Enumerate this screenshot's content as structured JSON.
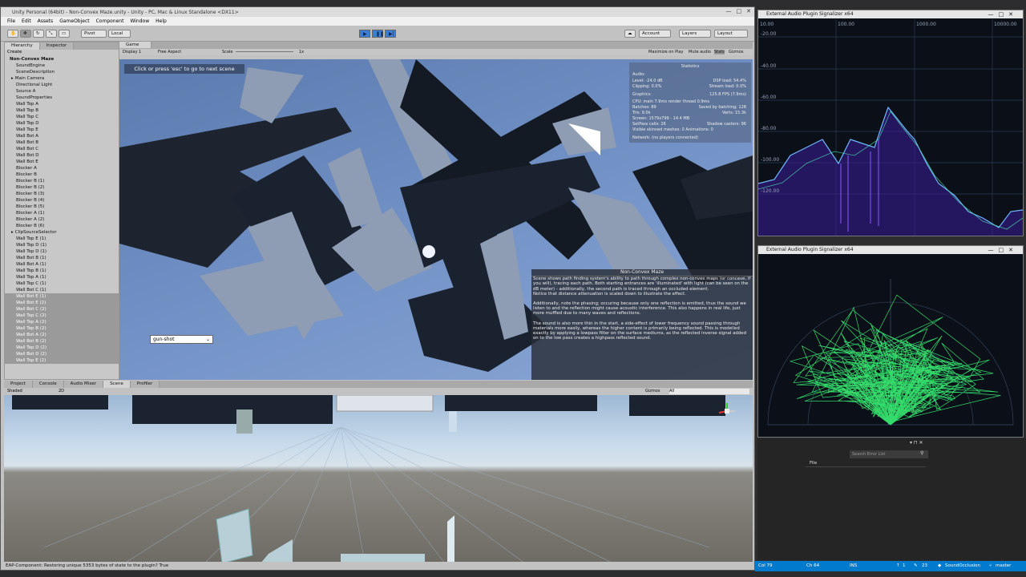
{
  "unity": {
    "window_title": "Unity Personal (64bit) - Non-Convex Maze.unity - Unity - PC, Mac & Linux Standalone <DX11>",
    "menu": [
      "File",
      "Edit",
      "Assets",
      "GameObject",
      "Component",
      "Window",
      "Help"
    ],
    "toolbar": {
      "pivot": "Pivot",
      "local": "Local",
      "account": "Account",
      "layers": "Layers",
      "layout": "Layout"
    },
    "hierarchy": {
      "tabs": [
        "Hierarchy",
        "Inspector"
      ],
      "create": "Create",
      "root": "Non-Convex Maze",
      "items": [
        "SoundEngine",
        "SceneDescription",
        "Main Camera",
        "Directional Light",
        "Source A",
        "SoundProperties",
        "Wall Top A",
        "Wall Top B",
        "Wall Top C",
        "Wall Top D",
        "Wall Top E",
        "Wall Bot A",
        "Wall Bot B",
        "Wall Bot C",
        "Wall Bot D",
        "Wall Bot E",
        "Blocker A",
        "Blocker B",
        "Blocker B (1)",
        "Blocker B (2)",
        "Blocker B (3)",
        "Blocker B (4)",
        "Blocker B (5)",
        "Blocker A (1)",
        "Blocker A (2)",
        "Blocker B (6)",
        "ClipSourceSelector",
        "Wall Top E (1)",
        "Wall Top D (1)",
        "Wall Top D (1)",
        "Wall Bot B (1)",
        "Wall Bot A (1)",
        "Wall Top B (1)",
        "Wall Top A (1)",
        "Wall Top C (1)",
        "Wall Bot C (1)",
        "Wall Bot E (1)",
        "Wall Bot E (2)",
        "Wall Bot C (2)",
        "Wall Top C (2)",
        "Wall Top A (2)",
        "Wall Top B (2)",
        "Wall Bot A (2)",
        "Wall Bot B (2)",
        "Wall Top D (2)",
        "Wall Bot D (2)",
        "Wall Top E (2)"
      ]
    },
    "game": {
      "tab": "Game",
      "display": "Display 1",
      "aspect": "Free Aspect",
      "scale_label": "Scale",
      "scale_value": "1x",
      "toggles": [
        "Maximize on Play",
        "Mute audio",
        "Stats",
        "Gizmos"
      ],
      "hint": "Click or press 'esc' to go to next scene",
      "dropdown": "gun-shot",
      "stats": {
        "title": "Statistics",
        "audio_label": "Audio:",
        "level": "Level: -24.0 dB",
        "clipping": "Clipping: 0.0%",
        "dsp": "DSP load: 54.4%",
        "stream": "Stream load: 0.0%",
        "graphics_label": "Graphics:",
        "fps": "125.8 FPS (7.9ms)",
        "cpu": "CPU: main 7.9ms  render thread 0.9ms",
        "batches": "Batches: 89",
        "saved": "Saved by batching: 128",
        "tris": "Tris: 9.0k",
        "verts": "Verts: 15.3k",
        "screen": "Screen: 1579x799 - 14.4 MB",
        "setpass": "SetPass calls: 26",
        "shadow": "Shadow casters: 96",
        "skinned": "Visible skinned meshes: 0  Animations: 0",
        "network": "Network: (no players connected)"
      },
      "info": {
        "title": "Non-Convex Maze",
        "p1": "Scene shows path finding system's ability to path through complex non-convex maps (or concave, if you will), tracing each path. Both starting entrances are 'illuminated' with light (can be seen on the dB meter) - additionally, the second path is traced through an occluded element.",
        "p2": "Notice that distance attenuation is scaled down to illustrate the effect.",
        "p3": "Additionally, note the phasing; occuring because only one reflection is emitted, thus the sound we listen to and the reflection might cause acoustic interference. This also happens in real life, just more muffled due to many waves and reflections.",
        "p4": "The sound is also more thin in the start, a side-effect of lower frequency sound passing through materials more easily, whereas the higher content is primarily being reflected. This is modelled exactly by applying a lowpass filter on the surface mediums, as the reflected inverse signal added on to the low pass creates a highpass reflected sound."
      }
    },
    "scene": {
      "tabs": [
        "Project",
        "Console",
        "Audio Mixer",
        "Scene",
        "Profiler"
      ],
      "shaded": "Shaded",
      "mode2d": "2D",
      "gizmos": "Gizmos",
      "search": "All"
    },
    "status": "EAP-Component: Restoring unique 5353 bytes of state to the plugin? True"
  },
  "spectrum": {
    "title": "External Audio Plugin Signalizer x64",
    "x_ticks": [
      "10.00",
      "100.00",
      "1000.00",
      "10000.00"
    ],
    "y_ticks": [
      "-20.00",
      "-40.00",
      "-60.00",
      "-80.00",
      "-100.00",
      "-120.00"
    ]
  },
  "oscilloscope": {
    "title": "External Audio Plugin Signalizer x64"
  },
  "errors": {
    "search": "Search Error List",
    "column": "File"
  },
  "vs_status": {
    "col": "Col 79",
    "ch": "Ch 64",
    "ins": "INS",
    "up": "1",
    "edits": "23",
    "project": "SoundOcclusion",
    "branch": "master"
  },
  "colors": {
    "accent": "#3b7fd4",
    "vs_blue": "#007acc",
    "spectrum_line": "#6fb8ff",
    "spectrum_fill": "#7a3cff",
    "osc_green": "#3cff7a"
  }
}
